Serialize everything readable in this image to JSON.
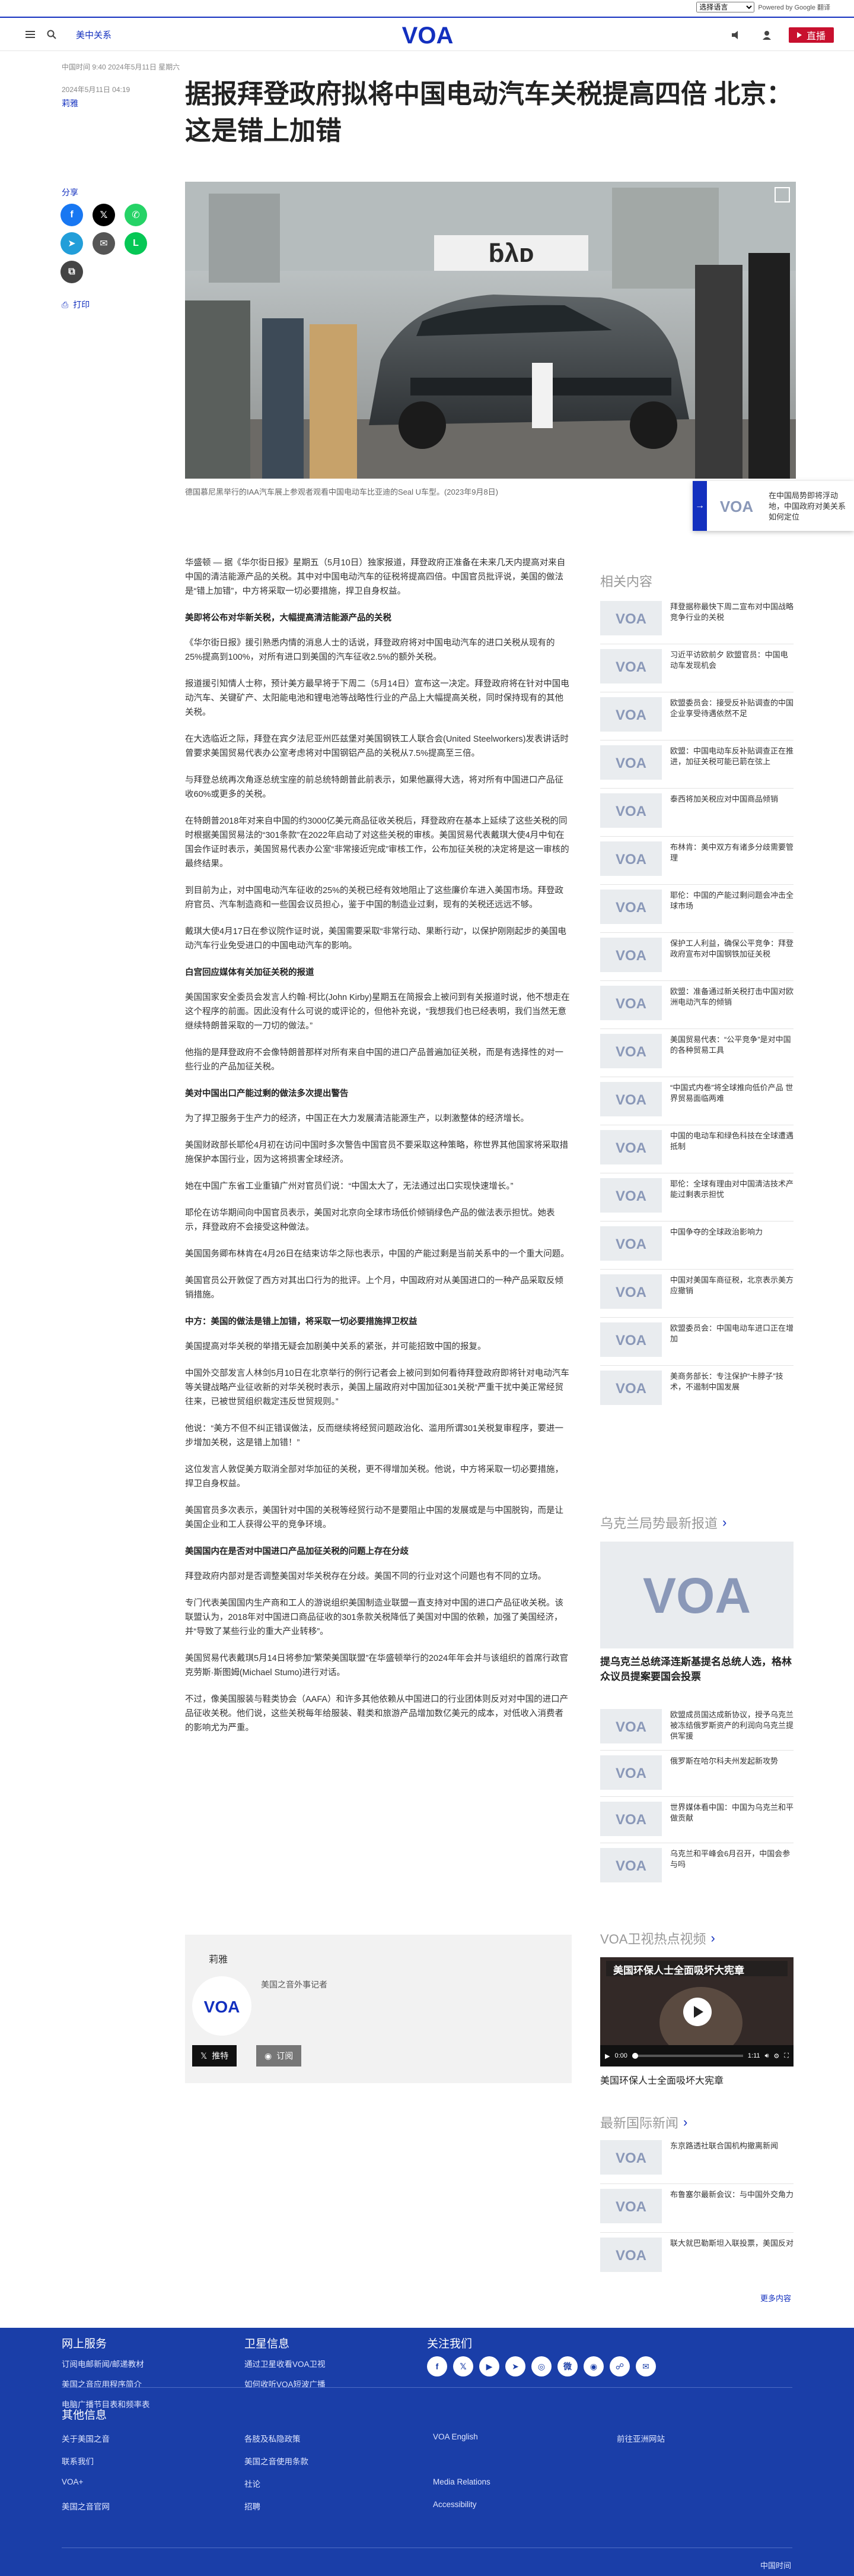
{
  "colors": {
    "brand": "#1330bf",
    "live": "#c8102e",
    "footer": "#1a3ea8"
  },
  "topbar": {
    "language_value": "选择语言",
    "powered_by": "Powered by Google 翻译"
  },
  "header": {
    "menu_icon": "menu-icon",
    "search_icon": "search-icon",
    "section_link": "美中关系",
    "logo_text": "VOA",
    "audio_icon": "speaker-icon",
    "user_icon": "user-icon",
    "live_label": "直播"
  },
  "dateline": {
    "updated": "中国时间 9:40 2024年5月11日 星期六",
    "published": "2024年5月11日 04:19",
    "author": "莉雅"
  },
  "headline": "据报拜登政府拟将中国电动汽车关税提高四倍 北京：这是错上加错",
  "share": {
    "label": "分享",
    "print_label": "打印"
  },
  "photo": {
    "caption": "德国慕尼黑举行的IAA汽车展上参观者观看中国电动车比亚迪的Seal U车型。(2023年9月8日)"
  },
  "article": {
    "paragraphs": [
      {
        "kind": "p",
        "text": "华盛顿 — 据《华尔街日报》星期五（5月10日）独家报道，拜登政府正准备在未来几天内提高对来自中国的清洁能源产品的关税。其中对中国电动汽车的征税将提高四倍。中国官员批评说，美国的做法是“错上加错”，中方将采取一切必要措施，捍卫自身权益。"
      },
      {
        "kind": "h",
        "text": "美即将公布对华新关税，大幅提高清洁能源产品的关税"
      },
      {
        "kind": "p",
        "text": "《华尔街日报》援引熟悉内情的消息人士的话说，拜登政府将对中国电动汽车的进口关税从现有的25%提高到100%，对所有进口到美国的汽车征收2.5%的额外关税。"
      },
      {
        "kind": "p",
        "text": "报道援引知情人士称，预计美方最早将于下周二（5月14日）宣布这一决定。拜登政府将在针对中国电动汽车、关键矿产、太阳能电池和锂电池等战略性行业的产品上大幅提高关税，同时保持现有的其他关税。"
      },
      {
        "kind": "p",
        "text": "在大选临近之际，拜登在宾夕法尼亚州匹兹堡对美国钢铁工人联合会(United Steelworkers)发表讲话时曾要求美国贸易代表办公室考虑将对中国钢铝产品的关税从7.5%提高至三倍。"
      },
      {
        "kind": "p",
        "text": "与拜登总统再次角逐总统宝座的前总统特朗普此前表示，如果他赢得大选，将对所有中国进口产品征收60%或更多的关税。"
      },
      {
        "kind": "p",
        "text": "在特朗普2018年对来自中国的约3000亿美元商品征收关税后，拜登政府在基本上延续了这些关税的同时根据美国贸易法的“301条款”在2022年启动了对这些关税的审核。美国贸易代表戴琪大使4月中旬在国会作证时表示，美国贸易代表办公室“非常接近完成”审核工作，公布加征关税的决定将是这一审核的最终结果。"
      },
      {
        "kind": "p",
        "text": "到目前为止，对中国电动汽车征收的25%的关税已经有效地阻止了这些廉价车进入美国市场。拜登政府官员、汽车制造商和一些国会议员担心，鉴于中国的制造业过剩，现有的关税还远远不够。"
      },
      {
        "kind": "p",
        "text": "戴琪大使4月17日在参议院作证时说，美国需要采取“非常行动、果断行动”，以保护刚刚起步的美国电动汽车行业免受进口的中国电动汽车的影响。"
      },
      {
        "kind": "h",
        "text": "白宫回应媒体有关加征关税的报道"
      },
      {
        "kind": "p",
        "text": "美国国家安全委员会发言人约翰·柯比(John Kirby)星期五在简报会上被问到有关报道时说，他不想走在这个程序的前面。因此没有什么可说的或评论的，但他补充说，“我想我们也已经表明，我们当然无意继续特朗普采取的一刀切的做法。”"
      },
      {
        "kind": "p",
        "text": "他指的是拜登政府不会像特朗普那样对所有来自中国的进口产品普遍加征关税，而是有选择性的对一些行业的产品加征关税。"
      },
      {
        "kind": "h",
        "text": "美对中国出口产能过剩的做法多次提出警告"
      },
      {
        "kind": "p",
        "text": "为了捍卫服务于生产力的经济，中国正在大力发展清洁能源生产，以刺激整体的经济增长。"
      },
      {
        "kind": "p",
        "text": "美国财政部长耶伦4月初在访问中国时多次警告中国官员不要采取这种策略，称世界其他国家将采取措施保护本国行业，因为这将损害全球经济。"
      },
      {
        "kind": "p",
        "text": "她在中国广东省工业重镇广州对官员们说：“中国太大了，无法通过出口实现快速增长。”"
      },
      {
        "kind": "p",
        "text": "耶伦在访华期间向中国官员表示，美国对北京向全球市场低价倾销绿色产品的做法表示担忧。她表示，拜登政府不会接受这种做法。"
      },
      {
        "kind": "p",
        "text": "美国国务卿布林肯在4月26日在结束访华之际也表示，中国的产能过剩是当前关系中的一个重大问题。"
      },
      {
        "kind": "p",
        "text": "美国官员公开敦促了西方对其出口行为的批评。上个月，中国政府对从美国进口的一种产品采取反倾销措施。"
      },
      {
        "kind": "h",
        "text": "中方：美国的做法是错上加错，将采取一切必要措施捍卫权益"
      },
      {
        "kind": "p",
        "text": "美国提高对华关税的举措无疑会加剧美中关系的紧张，并可能招致中国的报复。"
      },
      {
        "kind": "p",
        "text": "中国外交部发言人林剑5月10日在北京举行的例行记者会上被问到如何看待拜登政府即将针对电动汽车等关键战略产业征收新的对华关税时表示，美国上届政府对中国加征301关税“严重干扰中美正常经贸往来，已被世贸组织裁定违反世贸规则。”"
      },
      {
        "kind": "p",
        "text": "他说：“美方不但不纠正错误做法，反而继续将经贸问题政治化、滥用所谓301关税复审程序，要进一步增加关税，这是错上加错！”"
      },
      {
        "kind": "p",
        "text": "这位发言人敦促美方取消全部对华加征的关税，更不得增加关税。他说，中方将采取一切必要措施，捍卫自身权益。"
      },
      {
        "kind": "p",
        "text": "美国官员多次表示，美国针对中国的关税等经贸行动不是要阻止中国的发展或是与中国脱钩，而是让美国企业和工人获得公平的竞争环境。"
      },
      {
        "kind": "h",
        "text": "美国国内在是否对中国进口产品加征关税的问题上存在分歧"
      },
      {
        "kind": "p",
        "text": "拜登政府内部对是否调整美国对华关税存在分歧。美国不同的行业对这个问题也有不同的立场。"
      },
      {
        "kind": "p",
        "text": "专门代表美国国内生产商和工人的游说组织美国制造业联盟一直支持对中国的进口产品征收关税。该联盟认为，2018年对中国进口商品征收的301条款关税降低了美国对中国的依赖，加强了美国经济，并“导致了某些行业的重大产业转移”。"
      },
      {
        "kind": "p",
        "text": "美国贸易代表戴琪5月14日将参加“繁荣美国联盟”在华盛顿举行的2024年年会并与该组织的首席行政官克劳斯·斯图姆(Michael Stumo)进行对话。"
      },
      {
        "kind": "p",
        "text": "不过，像美国服装与鞋类协会（AAFA）和许多其他依赖从中国进口的行业团体则反对对中国的进口产品征收关税。他们说，这些关税每年给服装、鞋类和旅游产品增加数亿美元的成本，对低收入消费者的影响尤为严重。"
      }
    ]
  },
  "author_card": {
    "name": "莉雅",
    "role": "美国之音外事记者",
    "follow_label": "推特",
    "subscribe_label": "订阅"
  },
  "sidebar": {
    "related_title": "相关内容",
    "related": [
      "拜登据称最快下周二宣布对中国战略竞争行业的关税",
      "习近平访欧前夕 欧盟官员：中国电动车发现机会",
      "欧盟委员会：接受反补贴调查的中国企业享受待遇依然不足",
      "欧盟：中国电动车反补贴调查正在推进，加征关税可能已箭在弦上",
      "泰西将加关税应对中国商品倾销",
      "布林肯：美中双方有诸多分歧需要管理",
      "耶伦：中国的产能过剩问题会冲击全球市场",
      "保护工人利益，确保公平竞争：拜登政府宣布对中国钢铁加征关税",
      "欧盟：准备通过新关税打击中国对欧洲电动汽车的倾销",
      "美国贸易代表：“公平竞争”是对中国的各种贸易工具",
      "“中国式内卷”将全球推向低价产品 世界贸易面临两难",
      "中国的电动车和绿色科技在全球遭遇抵制",
      "耶伦：全球有理由对中国清洁技术产能过剩表示担忧",
      "中国争夺的全球政治影响力",
      "中国对美国车商征税，北京表示美方应撤销",
      "欧盟委员会：中国电动车进口正在增加",
      "美商务部长：专注保护“卡脖子”技术，不遏制中国发展"
    ],
    "ukraine_title": "乌克兰局势最新报道",
    "ukraine_feature": "提乌克兰总统泽连斯基提名总统人选，格林众议员提案要国会投票",
    "ukraine_items": [
      "欧盟成员国达成新协议，授予乌克兰被冻结俄罗斯资产的利润向乌克兰提供军援",
      "俄罗斯在哈尔科夫州发起新攻势",
      "世界媒体看中国：中国为乌克兰和平做贡献",
      "乌克兰和平峰会6月召开，中国会参与吗"
    ],
    "video_title": "VOA卫视热点视频",
    "video_caption": "美国环保人士全面吸坏大宪章",
    "video_time": "0:00",
    "video_duration": "1:11",
    "world_title": "最新国际新闻",
    "world_items": [
      "东京路透社联合国机构撤离新闻",
      "布鲁塞尔最新会议：与中国外交角力",
      "联大就巴勒斯坦入联投票，美国反对"
    ],
    "more_label": "更多内容"
  },
  "popup": {
    "text": "在中国局势即将浮动地，中国政府对美关系如何定位"
  },
  "footer": {
    "col1_title": "网上服务",
    "col1_links": [
      "订阅电邮新闻/邮递教材",
      "美国之音应用程序简介",
      "电脑广播节目表和频率表"
    ],
    "col2_title": "卫星信息",
    "col2_links": [
      "通过卫星收看VOA卫视",
      "如何收听VOA短波广播"
    ],
    "col3_title": "关注我们",
    "social": [
      "facebook-icon",
      "x-icon",
      "youtube-icon",
      "telegram-icon",
      "instagram-icon",
      "weibo-icon",
      "podcast-icon",
      "rss-icon",
      "email-icon"
    ],
    "other_title": "其他信息",
    "other_links": [
      [
        "关于美国之音",
        "各肢及私隐政策",
        "VOA English",
        "前往亚洲网站"
      ],
      [
        "联系我们",
        "美国之音使用条款",
        "",
        ""
      ],
      [
        "VOA+",
        "社论",
        "Media Relations",
        ""
      ],
      [
        "美国之音官网",
        "招聘",
        "Accessibility",
        ""
      ]
    ],
    "bottom_text": "中国时间"
  }
}
